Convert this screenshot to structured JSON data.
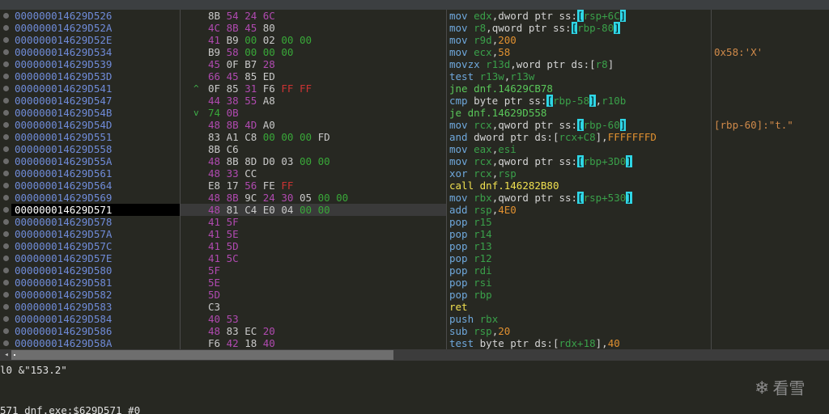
{
  "rows": [
    {
      "addr": "000000014629D526",
      "jmp": "",
      "bytes": [
        [
          "8B",
          "b0"
        ],
        [
          "54",
          "b1"
        ],
        [
          "24",
          "b1"
        ],
        [
          "6C",
          "b1"
        ]
      ],
      "asm": [
        [
          "mov ",
          "kw"
        ],
        [
          "edx",
          "reg"
        ],
        [
          ",dword ptr ss:",
          "txt"
        ],
        [
          "[",
          "hl"
        ],
        [
          "rsp+6C",
          "reg"
        ],
        [
          "]",
          "hl"
        ]
      ],
      "cmt": ""
    },
    {
      "addr": "000000014629D52A",
      "jmp": "",
      "bytes": [
        [
          "4C",
          "b1"
        ],
        [
          "8B",
          "b1"
        ],
        [
          "45",
          "b1"
        ],
        [
          "80",
          "b0"
        ]
      ],
      "asm": [
        [
          "mov ",
          "kw"
        ],
        [
          "r8",
          "reg"
        ],
        [
          ",qword ptr ss:",
          "txt"
        ],
        [
          "[",
          "hl"
        ],
        [
          "rbp-80",
          "reg"
        ],
        [
          "]",
          "hl"
        ]
      ],
      "cmt": ""
    },
    {
      "addr": "000000014629D52E",
      "jmp": "",
      "bytes": [
        [
          "41",
          "b1"
        ],
        [
          "B9",
          "b0"
        ],
        [
          "00",
          "b2"
        ],
        [
          "02",
          "b0"
        ],
        [
          "00",
          "b2"
        ],
        [
          "00",
          "b2"
        ]
      ],
      "asm": [
        [
          "mov ",
          "kw"
        ],
        [
          "r9d",
          "reg"
        ],
        [
          ",",
          "txt"
        ],
        [
          "200",
          "num"
        ]
      ],
      "cmt": ""
    },
    {
      "addr": "000000014629D534",
      "jmp": "",
      "bytes": [
        [
          "B9",
          "b0"
        ],
        [
          "58",
          "b1"
        ],
        [
          "00",
          "b2"
        ],
        [
          "00",
          "b2"
        ],
        [
          "00",
          "b2"
        ]
      ],
      "asm": [
        [
          "mov ",
          "kw"
        ],
        [
          "ecx",
          "reg"
        ],
        [
          ",",
          "txt"
        ],
        [
          "58",
          "num"
        ]
      ],
      "cmt": "0x58:'X'"
    },
    {
      "addr": "000000014629D539",
      "jmp": "",
      "bytes": [
        [
          "45",
          "b1"
        ],
        [
          "0F",
          "b0"
        ],
        [
          "B7",
          "b0"
        ],
        [
          "28",
          "b1"
        ]
      ],
      "asm": [
        [
          "movzx ",
          "kw"
        ],
        [
          "r13d",
          "reg"
        ],
        [
          ",word ptr ds:",
          "txt"
        ],
        [
          "[",
          "sym"
        ],
        [
          "r8",
          "reg"
        ],
        [
          "]",
          "sym"
        ]
      ],
      "cmt": ""
    },
    {
      "addr": "000000014629D53D",
      "jmp": "",
      "bytes": [
        [
          "66",
          "b1"
        ],
        [
          "45",
          "b1"
        ],
        [
          "85",
          "b0"
        ],
        [
          "ED",
          "b0"
        ]
      ],
      "asm": [
        [
          "test ",
          "kw"
        ],
        [
          "r13w",
          "reg"
        ],
        [
          ",",
          "txt"
        ],
        [
          "r13w",
          "reg"
        ]
      ],
      "cmt": ""
    },
    {
      "addr": "000000014629D541",
      "jmp": "^",
      "bytes": [
        [
          "0F",
          "b0"
        ],
        [
          "85",
          "b0"
        ],
        [
          "31",
          "b1"
        ],
        [
          "F6",
          "b0"
        ],
        [
          "FF",
          "b3"
        ],
        [
          "FF",
          "b3"
        ]
      ],
      "asm": [
        [
          "jne ",
          "kwg"
        ],
        [
          "dnf.14629CB78",
          "kwg"
        ]
      ],
      "cmt": ""
    },
    {
      "addr": "000000014629D547",
      "jmp": "",
      "bytes": [
        [
          "44",
          "b1"
        ],
        [
          "38",
          "b1"
        ],
        [
          "55",
          "b1"
        ],
        [
          "A8",
          "b0"
        ]
      ],
      "asm": [
        [
          "cmp ",
          "kw"
        ],
        [
          "byte ptr ss:",
          "txt"
        ],
        [
          "[",
          "hl"
        ],
        [
          "rbp-58",
          "reg"
        ],
        [
          "]",
          "hl"
        ],
        [
          ",",
          "txt"
        ],
        [
          "r10b",
          "reg"
        ]
      ],
      "cmt": ""
    },
    {
      "addr": "000000014629D54B",
      "jmp": "v",
      "bytes": [
        [
          "74",
          "b2"
        ],
        [
          "0B",
          "b1"
        ]
      ],
      "asm": [
        [
          "je ",
          "kwg"
        ],
        [
          "dnf.14629D558",
          "kwg"
        ]
      ],
      "cmt": ""
    },
    {
      "addr": "000000014629D54D",
      "jmp": "",
      "bytes": [
        [
          "48",
          "b1"
        ],
        [
          "8B",
          "b1"
        ],
        [
          "4D",
          "b1"
        ],
        [
          "A0",
          "b0"
        ]
      ],
      "asm": [
        [
          "mov ",
          "kw"
        ],
        [
          "rcx",
          "reg"
        ],
        [
          ",qword ptr ss:",
          "txt"
        ],
        [
          "[",
          "hl"
        ],
        [
          "rbp-60",
          "reg"
        ],
        [
          "]",
          "hl"
        ]
      ],
      "cmt": "[rbp-60]:\"t.\""
    },
    {
      "addr": "000000014629D551",
      "jmp": "",
      "bytes": [
        [
          "83",
          "b0"
        ],
        [
          "A1",
          "b0"
        ],
        [
          "C8",
          "b0"
        ],
        [
          "00",
          "b2"
        ],
        [
          "00",
          "b2"
        ],
        [
          "00",
          "b2"
        ],
        [
          "FD",
          "b0"
        ]
      ],
      "asm": [
        [
          "and ",
          "kw"
        ],
        [
          "dword ptr ds:",
          "txt"
        ],
        [
          "[",
          "sym"
        ],
        [
          "rcx+C8",
          "reg"
        ],
        [
          "]",
          "sym"
        ],
        [
          ",",
          "txt"
        ],
        [
          "FFFFFFFD",
          "num"
        ]
      ],
      "cmt": ""
    },
    {
      "addr": "000000014629D558",
      "jmp": "",
      "bytes": [
        [
          "8B",
          "b0"
        ],
        [
          "C6",
          "b0"
        ]
      ],
      "asm": [
        [
          "mov ",
          "kw"
        ],
        [
          "eax",
          "reg"
        ],
        [
          ",",
          "txt"
        ],
        [
          "esi",
          "reg"
        ]
      ],
      "cmt": ""
    },
    {
      "addr": "000000014629D55A",
      "jmp": "",
      "bytes": [
        [
          "48",
          "b1"
        ],
        [
          "8B",
          "b0"
        ],
        [
          "8D",
          "b0"
        ],
        [
          "D0",
          "b0"
        ],
        [
          "03",
          "b0"
        ],
        [
          "00",
          "b2"
        ],
        [
          "00",
          "b2"
        ]
      ],
      "asm": [
        [
          "mov ",
          "kw"
        ],
        [
          "rcx",
          "reg"
        ],
        [
          ",qword ptr ss:",
          "txt"
        ],
        [
          "[",
          "hl"
        ],
        [
          "rbp+3D0",
          "reg"
        ],
        [
          "]",
          "hl"
        ]
      ],
      "cmt": ""
    },
    {
      "addr": "000000014629D561",
      "jmp": "",
      "bytes": [
        [
          "48",
          "b1"
        ],
        [
          "33",
          "b1"
        ],
        [
          "CC",
          "b0"
        ]
      ],
      "asm": [
        [
          "xor ",
          "kw"
        ],
        [
          "rcx",
          "reg"
        ],
        [
          ",",
          "txt"
        ],
        [
          "rsp",
          "reg"
        ]
      ],
      "cmt": ""
    },
    {
      "addr": "000000014629D564",
      "jmp": "",
      "bytes": [
        [
          "E8",
          "b0"
        ],
        [
          "17",
          "b0"
        ],
        [
          "56",
          "b1"
        ],
        [
          "FE",
          "b0"
        ],
        [
          "FF",
          "b3"
        ]
      ],
      "asm": [
        [
          "call ",
          "kwy"
        ],
        [
          "dnf.146282B80",
          "kwy"
        ]
      ],
      "cmt": ""
    },
    {
      "addr": "000000014629D569",
      "jmp": "",
      "bytes": [
        [
          "48",
          "b1"
        ],
        [
          "8B",
          "b1"
        ],
        [
          "9C",
          "b0"
        ],
        [
          "24",
          "b1"
        ],
        [
          "30",
          "b1"
        ],
        [
          "05",
          "b0"
        ],
        [
          "00",
          "b2"
        ],
        [
          "00",
          "b2"
        ]
      ],
      "asm": [
        [
          "mov ",
          "kw"
        ],
        [
          "rbx",
          "reg"
        ],
        [
          ",qword ptr ss:",
          "txt"
        ],
        [
          "[",
          "hl"
        ],
        [
          "rsp+530",
          "reg"
        ],
        [
          "]",
          "hl"
        ]
      ],
      "cmt": ""
    },
    {
      "addr": "000000014629D571",
      "jmp": "",
      "cur": true,
      "bytes": [
        [
          "48",
          "b1"
        ],
        [
          "81",
          "b0"
        ],
        [
          "C4",
          "b0"
        ],
        [
          "E0",
          "b0"
        ],
        [
          "04",
          "b0"
        ],
        [
          "00",
          "b2"
        ],
        [
          "00",
          "b2"
        ]
      ],
      "asm": [
        [
          "add ",
          "kw"
        ],
        [
          "rsp",
          "reg"
        ],
        [
          ",",
          "txt"
        ],
        [
          "4E0",
          "num"
        ]
      ],
      "cmt": ""
    },
    {
      "addr": "000000014629D578",
      "jmp": "",
      "bytes": [
        [
          "41",
          "b1"
        ],
        [
          "5F",
          "b1"
        ]
      ],
      "asm": [
        [
          "pop ",
          "kw"
        ],
        [
          "r15",
          "reg"
        ]
      ],
      "cmt": ""
    },
    {
      "addr": "000000014629D57A",
      "jmp": "",
      "bytes": [
        [
          "41",
          "b1"
        ],
        [
          "5E",
          "b1"
        ]
      ],
      "asm": [
        [
          "pop ",
          "kw"
        ],
        [
          "r14",
          "reg"
        ]
      ],
      "cmt": ""
    },
    {
      "addr": "000000014629D57C",
      "jmp": "",
      "bytes": [
        [
          "41",
          "b1"
        ],
        [
          "5D",
          "b1"
        ]
      ],
      "asm": [
        [
          "pop ",
          "kw"
        ],
        [
          "r13",
          "reg"
        ]
      ],
      "cmt": ""
    },
    {
      "addr": "000000014629D57E",
      "jmp": "",
      "bytes": [
        [
          "41",
          "b1"
        ],
        [
          "5C",
          "b1"
        ]
      ],
      "asm": [
        [
          "pop ",
          "kw"
        ],
        [
          "r12",
          "reg"
        ]
      ],
      "cmt": ""
    },
    {
      "addr": "000000014629D580",
      "jmp": "",
      "bytes": [
        [
          "5F",
          "b1"
        ]
      ],
      "asm": [
        [
          "pop ",
          "kw"
        ],
        [
          "rdi",
          "reg"
        ]
      ],
      "cmt": ""
    },
    {
      "addr": "000000014629D581",
      "jmp": "",
      "bytes": [
        [
          "5E",
          "b1"
        ]
      ],
      "asm": [
        [
          "pop ",
          "kw"
        ],
        [
          "rsi",
          "reg"
        ]
      ],
      "cmt": ""
    },
    {
      "addr": "000000014629D582",
      "jmp": "",
      "bytes": [
        [
          "5D",
          "b1"
        ]
      ],
      "asm": [
        [
          "pop ",
          "kw"
        ],
        [
          "rbp",
          "reg"
        ]
      ],
      "cmt": ""
    },
    {
      "addr": "000000014629D583",
      "jmp": "",
      "bytes": [
        [
          "C3",
          "b0"
        ]
      ],
      "asm": [
        [
          "ret",
          "kwy"
        ]
      ],
      "cmt": ""
    },
    {
      "addr": "000000014629D584",
      "jmp": "",
      "bytes": [
        [
          "40",
          "b1"
        ],
        [
          "53",
          "b1"
        ]
      ],
      "asm": [
        [
          "push ",
          "kw"
        ],
        [
          "rbx",
          "reg"
        ]
      ],
      "cmt": ""
    },
    {
      "addr": "000000014629D586",
      "jmp": "",
      "bytes": [
        [
          "48",
          "b1"
        ],
        [
          "83",
          "b0"
        ],
        [
          "EC",
          "b0"
        ],
        [
          "20",
          "b1"
        ]
      ],
      "asm": [
        [
          "sub ",
          "kw"
        ],
        [
          "rsp",
          "reg"
        ],
        [
          ",",
          "txt"
        ],
        [
          "20",
          "num"
        ]
      ],
      "cmt": ""
    },
    {
      "addr": "000000014629D58A",
      "jmp": "",
      "bytes": [
        [
          "F6",
          "b0"
        ],
        [
          "42",
          "b1"
        ],
        [
          "18",
          "b0"
        ],
        [
          "40",
          "b1"
        ]
      ],
      "asm": [
        [
          "test ",
          "kw"
        ],
        [
          "byte ptr ds:",
          "txt"
        ],
        [
          "[",
          "sym"
        ],
        [
          "rdx+18",
          "reg"
        ],
        [
          "]",
          "sym"
        ],
        [
          ",",
          "txt"
        ],
        [
          "40",
          "num"
        ]
      ],
      "cmt": ""
    }
  ],
  "info": {
    "line1": "l0 &\"153.2\"",
    "line2": "571 dnf.exe:$629D571 #0"
  },
  "watermark": {
    "text": "看雪"
  },
  "colors": {
    "background": "#272822",
    "address": "#6f8bd8",
    "mnemonic": "#6fa8dc",
    "register": "#3aa04a",
    "immediate": "#e09030"
  }
}
